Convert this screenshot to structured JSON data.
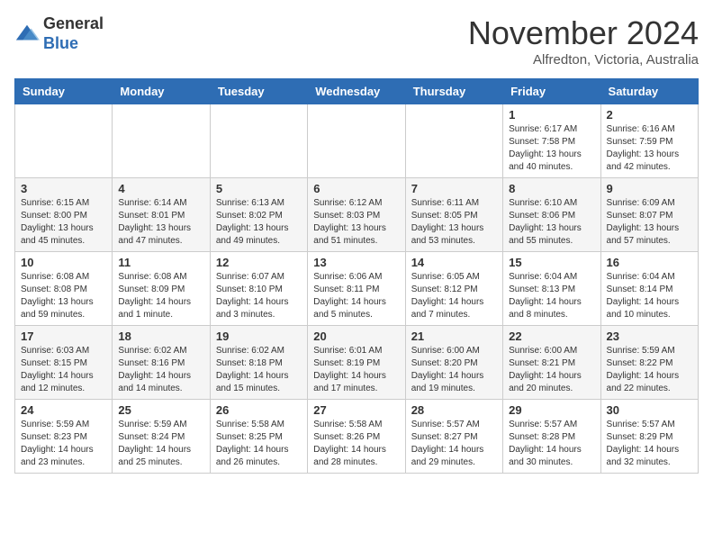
{
  "logo": {
    "general": "General",
    "blue": "Blue"
  },
  "header": {
    "month": "November 2024",
    "location": "Alfredton, Victoria, Australia"
  },
  "weekdays": [
    "Sunday",
    "Monday",
    "Tuesday",
    "Wednesday",
    "Thursday",
    "Friday",
    "Saturday"
  ],
  "weeks": [
    [
      {
        "day": "",
        "sunrise": "",
        "sunset": "",
        "daylight": ""
      },
      {
        "day": "",
        "sunrise": "",
        "sunset": "",
        "daylight": ""
      },
      {
        "day": "",
        "sunrise": "",
        "sunset": "",
        "daylight": ""
      },
      {
        "day": "",
        "sunrise": "",
        "sunset": "",
        "daylight": ""
      },
      {
        "day": "",
        "sunrise": "",
        "sunset": "",
        "daylight": ""
      },
      {
        "day": "1",
        "sunrise": "Sunrise: 6:17 AM",
        "sunset": "Sunset: 7:58 PM",
        "daylight": "Daylight: 13 hours and 40 minutes."
      },
      {
        "day": "2",
        "sunrise": "Sunrise: 6:16 AM",
        "sunset": "Sunset: 7:59 PM",
        "daylight": "Daylight: 13 hours and 42 minutes."
      }
    ],
    [
      {
        "day": "3",
        "sunrise": "Sunrise: 6:15 AM",
        "sunset": "Sunset: 8:00 PM",
        "daylight": "Daylight: 13 hours and 45 minutes."
      },
      {
        "day": "4",
        "sunrise": "Sunrise: 6:14 AM",
        "sunset": "Sunset: 8:01 PM",
        "daylight": "Daylight: 13 hours and 47 minutes."
      },
      {
        "day": "5",
        "sunrise": "Sunrise: 6:13 AM",
        "sunset": "Sunset: 8:02 PM",
        "daylight": "Daylight: 13 hours and 49 minutes."
      },
      {
        "day": "6",
        "sunrise": "Sunrise: 6:12 AM",
        "sunset": "Sunset: 8:03 PM",
        "daylight": "Daylight: 13 hours and 51 minutes."
      },
      {
        "day": "7",
        "sunrise": "Sunrise: 6:11 AM",
        "sunset": "Sunset: 8:05 PM",
        "daylight": "Daylight: 13 hours and 53 minutes."
      },
      {
        "day": "8",
        "sunrise": "Sunrise: 6:10 AM",
        "sunset": "Sunset: 8:06 PM",
        "daylight": "Daylight: 13 hours and 55 minutes."
      },
      {
        "day": "9",
        "sunrise": "Sunrise: 6:09 AM",
        "sunset": "Sunset: 8:07 PM",
        "daylight": "Daylight: 13 hours and 57 minutes."
      }
    ],
    [
      {
        "day": "10",
        "sunrise": "Sunrise: 6:08 AM",
        "sunset": "Sunset: 8:08 PM",
        "daylight": "Daylight: 13 hours and 59 minutes."
      },
      {
        "day": "11",
        "sunrise": "Sunrise: 6:08 AM",
        "sunset": "Sunset: 8:09 PM",
        "daylight": "Daylight: 14 hours and 1 minute."
      },
      {
        "day": "12",
        "sunrise": "Sunrise: 6:07 AM",
        "sunset": "Sunset: 8:10 PM",
        "daylight": "Daylight: 14 hours and 3 minutes."
      },
      {
        "day": "13",
        "sunrise": "Sunrise: 6:06 AM",
        "sunset": "Sunset: 8:11 PM",
        "daylight": "Daylight: 14 hours and 5 minutes."
      },
      {
        "day": "14",
        "sunrise": "Sunrise: 6:05 AM",
        "sunset": "Sunset: 8:12 PM",
        "daylight": "Daylight: 14 hours and 7 minutes."
      },
      {
        "day": "15",
        "sunrise": "Sunrise: 6:04 AM",
        "sunset": "Sunset: 8:13 PM",
        "daylight": "Daylight: 14 hours and 8 minutes."
      },
      {
        "day": "16",
        "sunrise": "Sunrise: 6:04 AM",
        "sunset": "Sunset: 8:14 PM",
        "daylight": "Daylight: 14 hours and 10 minutes."
      }
    ],
    [
      {
        "day": "17",
        "sunrise": "Sunrise: 6:03 AM",
        "sunset": "Sunset: 8:15 PM",
        "daylight": "Daylight: 14 hours and 12 minutes."
      },
      {
        "day": "18",
        "sunrise": "Sunrise: 6:02 AM",
        "sunset": "Sunset: 8:16 PM",
        "daylight": "Daylight: 14 hours and 14 minutes."
      },
      {
        "day": "19",
        "sunrise": "Sunrise: 6:02 AM",
        "sunset": "Sunset: 8:18 PM",
        "daylight": "Daylight: 14 hours and 15 minutes."
      },
      {
        "day": "20",
        "sunrise": "Sunrise: 6:01 AM",
        "sunset": "Sunset: 8:19 PM",
        "daylight": "Daylight: 14 hours and 17 minutes."
      },
      {
        "day": "21",
        "sunrise": "Sunrise: 6:00 AM",
        "sunset": "Sunset: 8:20 PM",
        "daylight": "Daylight: 14 hours and 19 minutes."
      },
      {
        "day": "22",
        "sunrise": "Sunrise: 6:00 AM",
        "sunset": "Sunset: 8:21 PM",
        "daylight": "Daylight: 14 hours and 20 minutes."
      },
      {
        "day": "23",
        "sunrise": "Sunrise: 5:59 AM",
        "sunset": "Sunset: 8:22 PM",
        "daylight": "Daylight: 14 hours and 22 minutes."
      }
    ],
    [
      {
        "day": "24",
        "sunrise": "Sunrise: 5:59 AM",
        "sunset": "Sunset: 8:23 PM",
        "daylight": "Daylight: 14 hours and 23 minutes."
      },
      {
        "day": "25",
        "sunrise": "Sunrise: 5:59 AM",
        "sunset": "Sunset: 8:24 PM",
        "daylight": "Daylight: 14 hours and 25 minutes."
      },
      {
        "day": "26",
        "sunrise": "Sunrise: 5:58 AM",
        "sunset": "Sunset: 8:25 PM",
        "daylight": "Daylight: 14 hours and 26 minutes."
      },
      {
        "day": "27",
        "sunrise": "Sunrise: 5:58 AM",
        "sunset": "Sunset: 8:26 PM",
        "daylight": "Daylight: 14 hours and 28 minutes."
      },
      {
        "day": "28",
        "sunrise": "Sunrise: 5:57 AM",
        "sunset": "Sunset: 8:27 PM",
        "daylight": "Daylight: 14 hours and 29 minutes."
      },
      {
        "day": "29",
        "sunrise": "Sunrise: 5:57 AM",
        "sunset": "Sunset: 8:28 PM",
        "daylight": "Daylight: 14 hours and 30 minutes."
      },
      {
        "day": "30",
        "sunrise": "Sunrise: 5:57 AM",
        "sunset": "Sunset: 8:29 PM",
        "daylight": "Daylight: 14 hours and 32 minutes."
      }
    ]
  ]
}
